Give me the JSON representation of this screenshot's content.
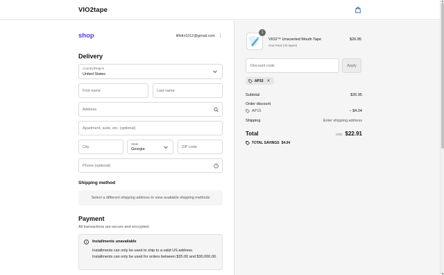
{
  "header": {
    "brand": "VIO2tape",
    "cart_icon": "shopping-bag-icon"
  },
  "account": {
    "shop_logo": "shop",
    "email": "lilfelix1012@gmail.com",
    "menu_glyph": "⋮"
  },
  "delivery": {
    "title": "Delivery",
    "country_label": "Country/Region",
    "country_value": "United States",
    "first_name_placeholder": "First name",
    "last_name_placeholder": "Last name",
    "address_placeholder": "Address",
    "apartment_placeholder": "Apartment, suite, etc. (optional)",
    "city_placeholder": "City",
    "state_label": "State",
    "state_value": "Georgia",
    "zip_placeholder": "ZIP code",
    "phone_placeholder": "Phone (optional)"
  },
  "shipping_method": {
    "title": "Shipping method",
    "note": "Select a different shipping address to view available shipping methods"
  },
  "payment": {
    "title": "Payment",
    "subtitle": "All transactions are secure and encrypted.",
    "installments_title": "Installments unavailable",
    "installments_line1": "Installments can only be used to ship to a valid US address.",
    "installments_line2": "Installments can only be used for orders between $35.00 and $30,000.00."
  },
  "order": {
    "quantity": "1",
    "product_name": "VIO2™ Unscented Mouth Tape",
    "product_variant": "One Pack (40 tapes)",
    "product_price": "$26.95",
    "discount_placeholder": "Discount code",
    "apply_label": "Apply",
    "applied_code": "AP15",
    "subtotal_label": "Subtotal",
    "subtotal_value": "$26.95",
    "order_discount_label": "Order discount",
    "discount_code": "AP15",
    "discount_value": "− $4.04",
    "shipping_label": "Shipping",
    "shipping_value": "Enter shipping address",
    "total_label": "Total",
    "currency": "USD",
    "total_value": "$22.91",
    "savings_label": "TOTAL SAVINGS",
    "savings_value": "$4.04"
  },
  "colors": {
    "shop_brand": "#5a31f4",
    "summary_bg": "#f5f5f5",
    "border": "#d9d9d9"
  }
}
